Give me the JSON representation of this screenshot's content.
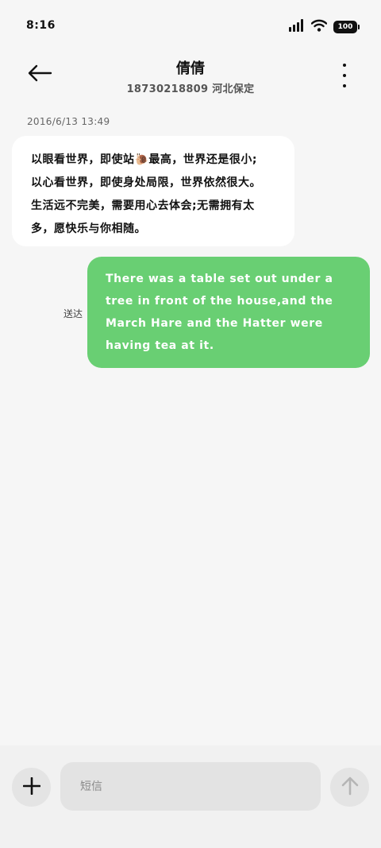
{
  "status_bar": {
    "time": "8:16",
    "battery": "100"
  },
  "header": {
    "title": "倩倩",
    "subtitle": "18730218809  河北保定"
  },
  "messages": [
    {
      "direction": "incoming",
      "timestamp": "2016/6/13  13:49",
      "lines": [
        "以眼看世界，即使站🐌最高，世界还是很小;",
        "以心看世界，即使身处局限，世界依然很大。",
        "生活远不完美，需要用心去体会;无需拥有太",
        "多，愿快乐与你相随。"
      ]
    },
    {
      "direction": "outgoing",
      "status": "送达",
      "lines": [
        "There was a table set out under a",
        "tree in front of the house,and the",
        "March Hare and the Hatter were",
        "having tea at it."
      ]
    }
  ],
  "composer": {
    "placeholder": "短信"
  },
  "colors": {
    "outgoing_bubble": "#69cf73",
    "incoming_bubble": "#ffffff",
    "background": "#f6f6f6"
  },
  "icons": [
    "signal-icon",
    "wifi-icon",
    "battery-icon",
    "back-arrow-icon",
    "more-vertical-icon",
    "plus-icon",
    "send-arrow-icon"
  ]
}
